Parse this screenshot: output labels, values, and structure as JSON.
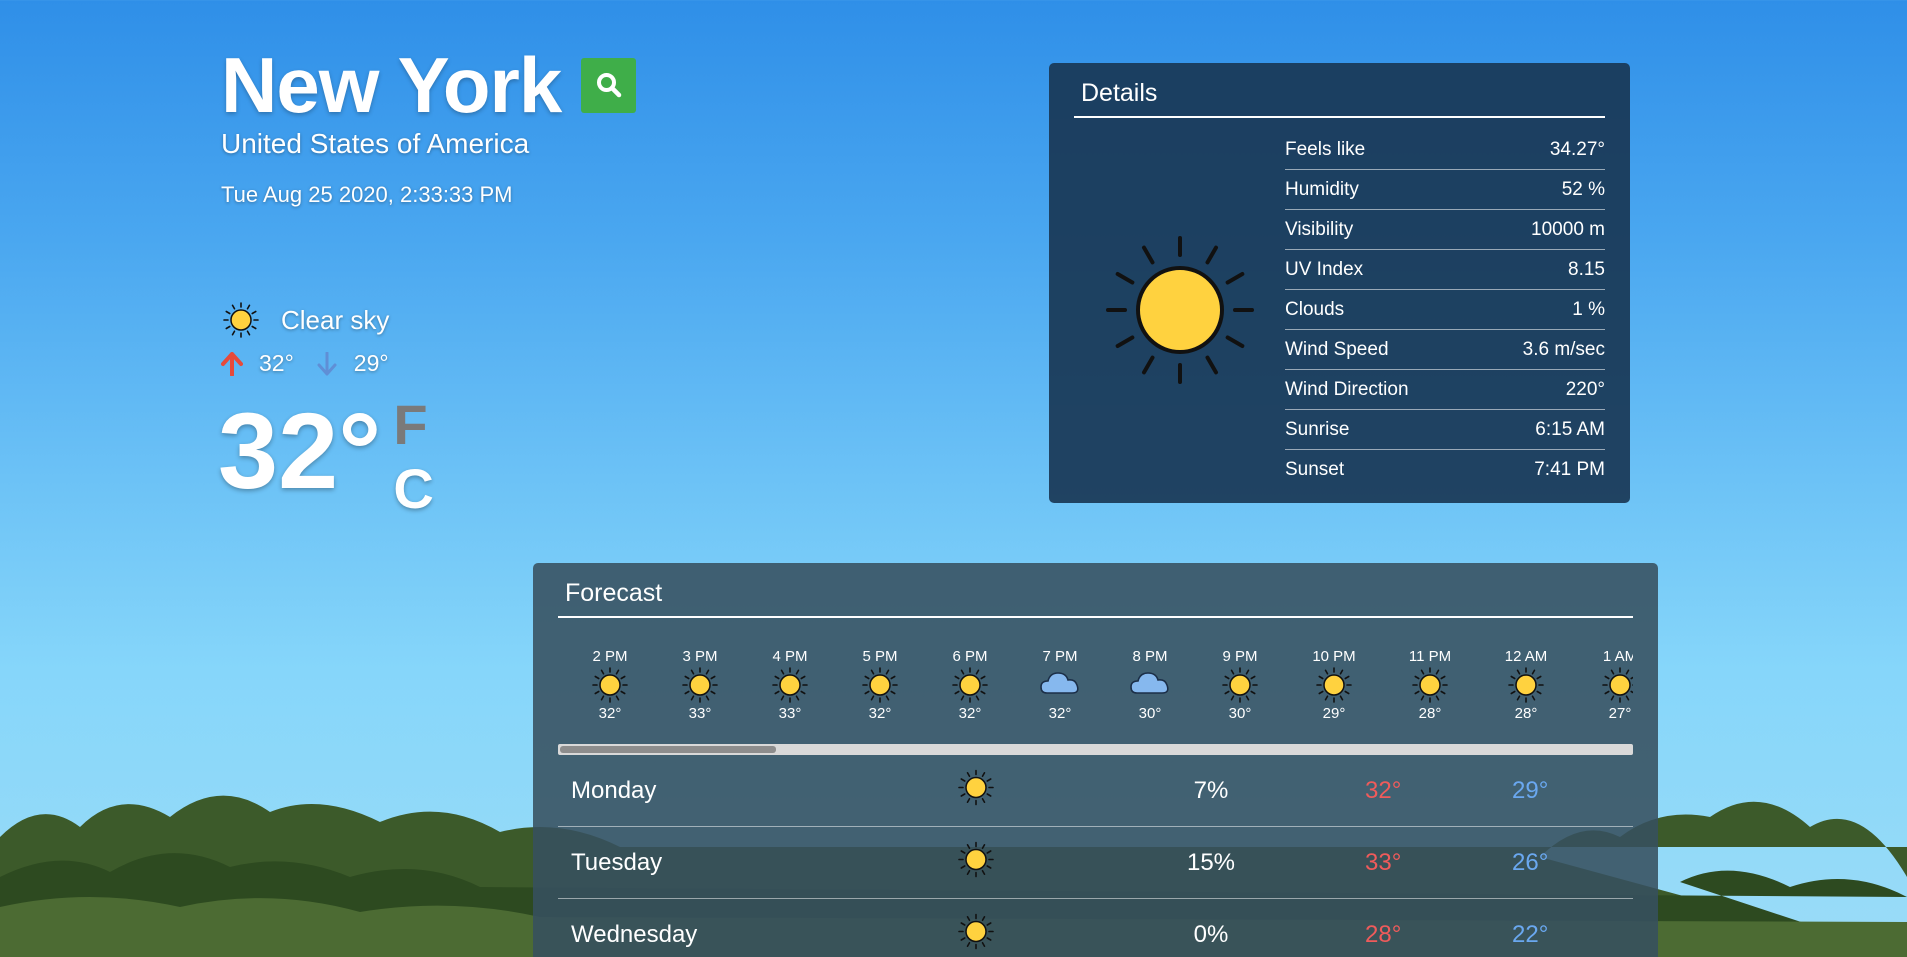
{
  "location": {
    "city": "New York",
    "country": "United States of America",
    "datetime": "Tue Aug 25 2020, 2:33:33 PM"
  },
  "current": {
    "condition": "Clear sky",
    "high": "32°",
    "low": "29°",
    "temp": "32°",
    "unit_f": "F",
    "unit_c": "C",
    "active_unit": "C"
  },
  "details": {
    "title": "Details",
    "rows": [
      {
        "label": "Feels like",
        "value": "34.27°"
      },
      {
        "label": "Humidity",
        "value": "52 %"
      },
      {
        "label": "Visibility",
        "value": "10000 m"
      },
      {
        "label": "UV Index",
        "value": "8.15"
      },
      {
        "label": "Clouds",
        "value": "1 %"
      },
      {
        "label": "Wind Speed",
        "value": "3.6 m/sec"
      },
      {
        "label": "Wind Direction",
        "value": "220°"
      },
      {
        "label": "Sunrise",
        "value": "6:15 AM"
      },
      {
        "label": "Sunset",
        "value": "7:41 PM"
      }
    ]
  },
  "forecast": {
    "title": "Forecast",
    "hourly": [
      {
        "time": "2 PM",
        "icon": "sun-icon",
        "temp": "32°"
      },
      {
        "time": "3 PM",
        "icon": "sun-icon",
        "temp": "33°"
      },
      {
        "time": "4 PM",
        "icon": "sun-icon",
        "temp": "33°"
      },
      {
        "time": "5 PM",
        "icon": "sun-icon",
        "temp": "32°"
      },
      {
        "time": "6 PM",
        "icon": "sun-icon",
        "temp": "32°"
      },
      {
        "time": "7 PM",
        "icon": "cloud-icon",
        "temp": "32°"
      },
      {
        "time": "8 PM",
        "icon": "cloud-icon",
        "temp": "30°"
      },
      {
        "time": "9 PM",
        "icon": "sun-icon",
        "temp": "30°"
      },
      {
        "time": "10 PM",
        "icon": "sun-icon",
        "temp": "29°"
      },
      {
        "time": "11 PM",
        "icon": "sun-icon",
        "temp": "28°"
      },
      {
        "time": "12 AM",
        "icon": "sun-icon",
        "temp": "28°"
      },
      {
        "time": "1 AM",
        "icon": "sun-icon",
        "temp": "27°"
      }
    ],
    "daily": [
      {
        "day": "Monday",
        "icon": "sun-icon",
        "pop": "7%",
        "high": "32°",
        "low": "29°"
      },
      {
        "day": "Tuesday",
        "icon": "sun-icon",
        "pop": "15%",
        "high": "33°",
        "low": "26°"
      },
      {
        "day": "Wednesday",
        "icon": "sun-icon",
        "pop": "0%",
        "high": "28°",
        "low": "22°"
      }
    ]
  },
  "colors": {
    "search_button": "#3fae49",
    "high_temp": "#f05b5b",
    "low_temp": "#6aa8f0",
    "sun_fill": "#ffd23f"
  }
}
